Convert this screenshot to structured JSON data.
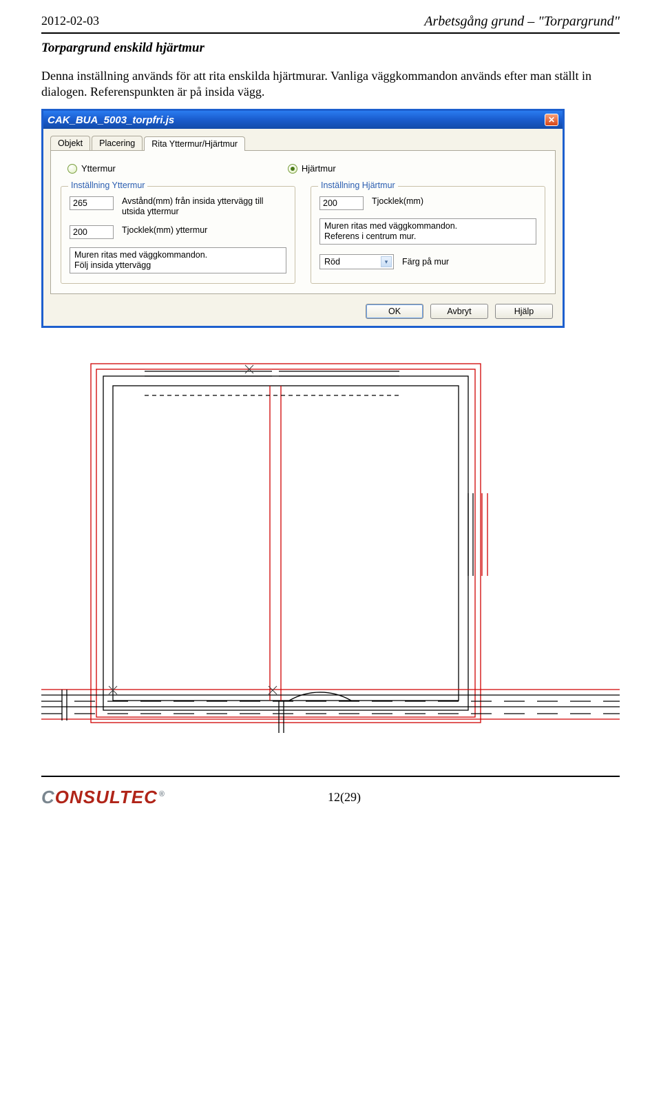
{
  "header": {
    "date": "2012-02-03",
    "doc_title": "Arbetsgång grund – \"Torpargrund\""
  },
  "section": {
    "heading": "Torpargrund enskild hjärtmur",
    "paragraph": "Denna inställning används för att rita enskilda hjärtmurar. Vanliga väggkommandon används efter man ställt in dialogen. Referenspunkten är på insida vägg."
  },
  "dialog": {
    "title": "CAK_BUA_5003_torpfri.js",
    "tabs": {
      "objekt": "Objekt",
      "placering": "Placering",
      "rita": "Rita Yttermur/Hjärtmur"
    },
    "radios": {
      "yttermur": "Yttermur",
      "hjartmur": "Hjärtmur"
    },
    "yttermur": {
      "legend": "Inställning Yttermur",
      "avstand_value": "265",
      "avstand_label": "Avstånd(mm) från insida yttervägg till utsida yttermur",
      "tjocklek_value": "200",
      "tjocklek_label": "Tjocklek(mm) yttermur",
      "note1": "Muren ritas med väggkommandon.",
      "note2": "Följ insida yttervägg"
    },
    "hjartmur": {
      "legend": "Inställning Hjärtmur",
      "tjocklek_value": "200",
      "tjocklek_label": "Tjocklek(mm)",
      "note1": "Muren ritas med väggkommandon.",
      "note2": "Referens i centrum mur.",
      "farg_value": "Röd",
      "farg_label": "Färg på mur"
    },
    "buttons": {
      "ok": "OK",
      "avbryt": "Avbryt",
      "hjalp": "Hjälp"
    }
  },
  "footer": {
    "logo_c": "C",
    "logo_rest": "ONSULTEC",
    "page": "12(29)"
  }
}
